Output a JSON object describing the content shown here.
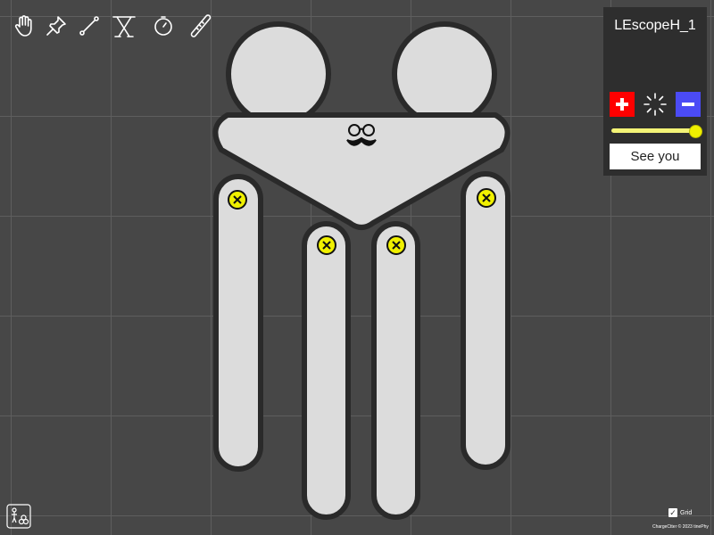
{
  "toolbar": {
    "tools": [
      {
        "name": "hand-icon"
      },
      {
        "name": "pin-icon"
      },
      {
        "name": "line-icon"
      },
      {
        "name": "stand-icon"
      },
      {
        "name": "stopwatch-icon"
      },
      {
        "name": "ruler-icon"
      }
    ]
  },
  "panel": {
    "title": "LEscopeH_1",
    "see_button_label": "See you",
    "slider_fraction": 1.0,
    "colors": {
      "plus": "#ff0000",
      "minus": "#4b4bf5",
      "slider": "#f3f376"
    }
  },
  "footer": {
    "grid_label": "Grid",
    "grid_checked": true,
    "copyright": "ChargeCtter © 2023 tinePhy"
  },
  "scene": {
    "fill_color": "#dcdcdc",
    "outline_color": "#2a2a2a",
    "charge_marker_color": "#f0f000"
  }
}
